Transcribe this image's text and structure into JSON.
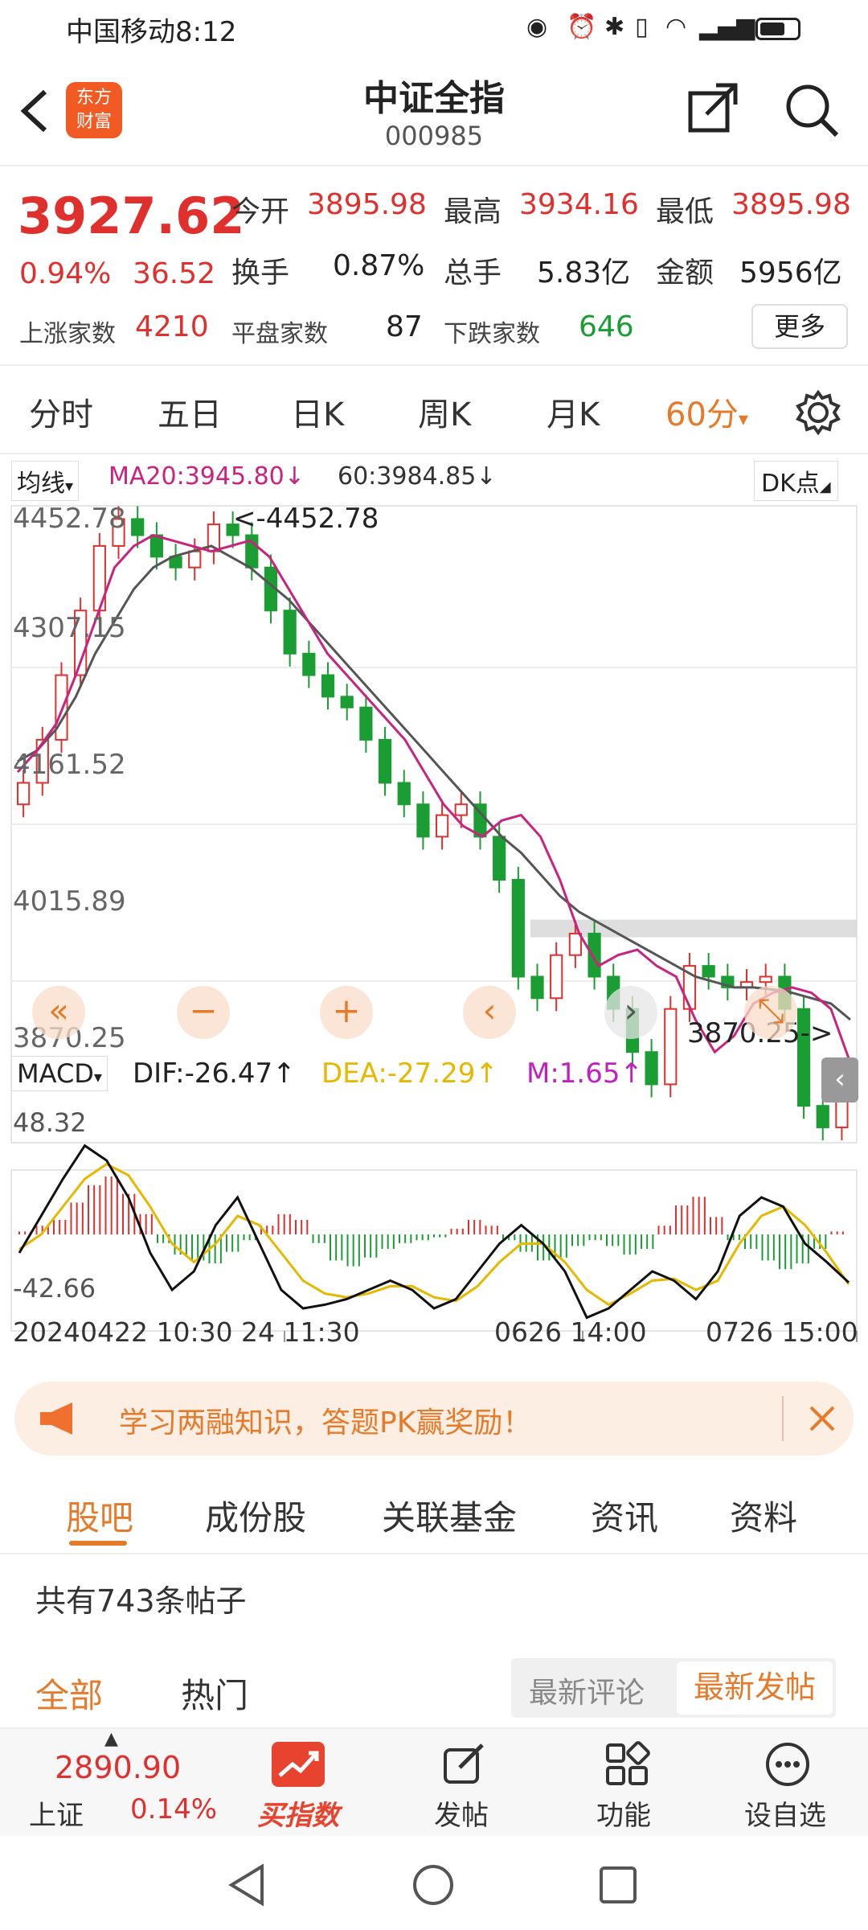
{
  "status": {
    "carrier": "中国移动",
    "time": "8:12"
  },
  "header": {
    "logo_text": "东方财富",
    "title": "中证全指",
    "code": "000985"
  },
  "quote": {
    "price": "3927.62",
    "change_pct": "0.94%",
    "change": "36.52",
    "open_label": "今开",
    "open": "3895.98",
    "high_label": "最高",
    "high": "3934.16",
    "low_label": "最低",
    "low": "3895.98",
    "turnover_label": "换手",
    "turnover": "0.87%",
    "volume_label": "总手",
    "volume": "5.83亿",
    "amount_label": "金额",
    "amount": "5956亿",
    "up_label": "上涨家数",
    "up": "4210",
    "flat_label": "平盘家数",
    "flat": "87",
    "down_label": "下跌家数",
    "down": "646",
    "more_label": "更多"
  },
  "period_tabs": [
    "分时",
    "五日",
    "日K",
    "周K",
    "月K",
    "60分"
  ],
  "main_chart": {
    "indicator_label": "均线",
    "ma20": "MA20:3945.80",
    "ma60": "60:3984.85",
    "dk_label": "DK点",
    "high_mark": "<-4452.78",
    "low_mark": "3870.25->",
    "ylabels": [
      "4452.78",
      "4307.15",
      "4161.52",
      "4015.89",
      "3870.25"
    ]
  },
  "macd": {
    "label": "MACD",
    "dif": "DIF:-26.47",
    "dea": "DEA:-27.29",
    "m": "M:1.65",
    "ymax": "48.32",
    "ymin": "-42.66"
  },
  "xaxis": {
    "d1": "20240422 10:30",
    "d1b": "24 11:30",
    "d2": "0626 14:00",
    "d3": "0726 15:00"
  },
  "chart_data": {
    "type": "candlestick",
    "ylim": [
      3870.25,
      4452.78
    ],
    "ma20_color": "#c8247e",
    "ma60_color": "#555555",
    "ma20": [
      4210,
      4230,
      4255,
      4300,
      4350,
      4400,
      4420,
      4430,
      4425,
      4420,
      4415,
      4420,
      4425,
      4410,
      4380,
      4350,
      4320,
      4300,
      4280,
      4260,
      4240,
      4210,
      4180,
      4160,
      4150,
      4165,
      4170,
      4150,
      4110,
      4060,
      4030,
      4040,
      4045,
      4030,
      4020,
      3980,
      3950,
      3965,
      3995,
      4005,
      4010,
      4005,
      3990,
      3940
    ],
    "ma60": [
      4220,
      4230,
      4250,
      4280,
      4320,
      4350,
      4380,
      4400,
      4410,
      4415,
      4420,
      4410,
      4400,
      4385,
      4370,
      4350,
      4330,
      4310,
      4290,
      4270,
      4250,
      4230,
      4210,
      4190,
      4170,
      4150,
      4135,
      4115,
      4095,
      4080,
      4070,
      4060,
      4050,
      4040,
      4030,
      4020,
      4015,
      4010,
      4010,
      4008,
      4005,
      4000,
      3995,
      3980
    ],
    "closes": [
      4200,
      4240,
      4300,
      4360,
      4420,
      4445,
      4430,
      4410,
      4400,
      4415,
      4440,
      4430,
      4400,
      4360,
      4320,
      4300,
      4280,
      4270,
      4240,
      4200,
      4180,
      4150,
      4170,
      4180,
      4150,
      4110,
      4020,
      4000,
      4040,
      4060,
      4020,
      3990,
      3950,
      3920,
      3990,
      4030,
      4020,
      4010,
      4015,
      4020,
      3990,
      3900,
      3880,
      3927
    ]
  },
  "banner": {
    "text": "学习两融知识，答题PK赢奖励！"
  },
  "sub_tabs": [
    "股吧",
    "成份股",
    "关联基金",
    "资讯",
    "资料"
  ],
  "posts": {
    "count_text": "共有743条帖子",
    "filter_all": "全部",
    "filter_hot": "热门",
    "sort_comment": "最新评论",
    "sort_post": "最新发帖"
  },
  "bottom": {
    "index_value": "2890.90",
    "index_name": "上证",
    "index_pct": "0.14%",
    "buy": "买指数",
    "post": "发帖",
    "func": "功能",
    "watch": "设自选"
  }
}
